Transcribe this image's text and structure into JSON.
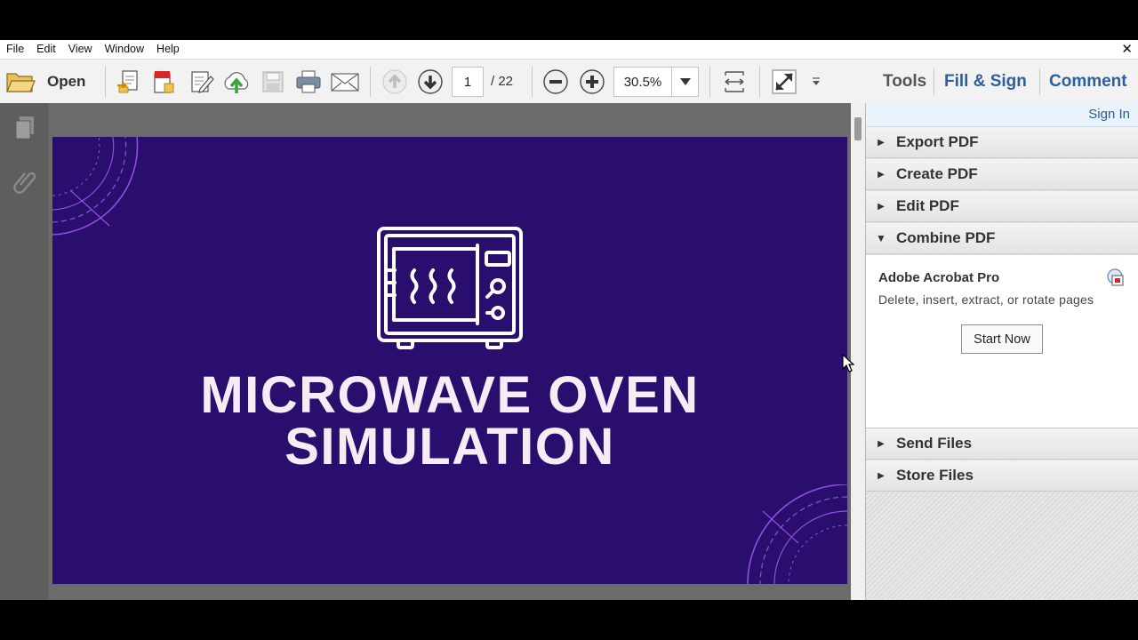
{
  "menu": [
    "File",
    "Edit",
    "View",
    "Window",
    "Help"
  ],
  "toolbar": {
    "open_label": "Open",
    "page_current": "1",
    "page_total": "/ 22",
    "zoom": "30.5%",
    "tabs": [
      "Tools",
      "Fill & Sign",
      "Comment"
    ]
  },
  "document": {
    "slide_title_line1": "MICROWAVE OVEN",
    "slide_title_line2": "SIMULATION",
    "slide_background": "#2a0e6e"
  },
  "right_panel": {
    "sign_in": "Sign In",
    "sections_top": [
      "Export PDF",
      "Create PDF",
      "Edit PDF",
      "Combine PDF"
    ],
    "combine": {
      "product": "Adobe Acrobat Pro",
      "description": "Delete, insert, extract, or rotate pages",
      "button": "Start Now"
    },
    "sections_bottom": [
      "Send Files",
      "Store Files"
    ]
  },
  "icons": [
    "folder-open-icon",
    "convert-pdf-icon",
    "create-pdf-icon",
    "edit-icon",
    "upload-cloud-icon",
    "save-icon",
    "print-icon",
    "email-icon",
    "page-up-icon",
    "page-down-icon",
    "zoom-out-icon",
    "zoom-in-icon",
    "fit-width-icon",
    "full-screen-icon",
    "pages-icon",
    "attachment-icon"
  ]
}
